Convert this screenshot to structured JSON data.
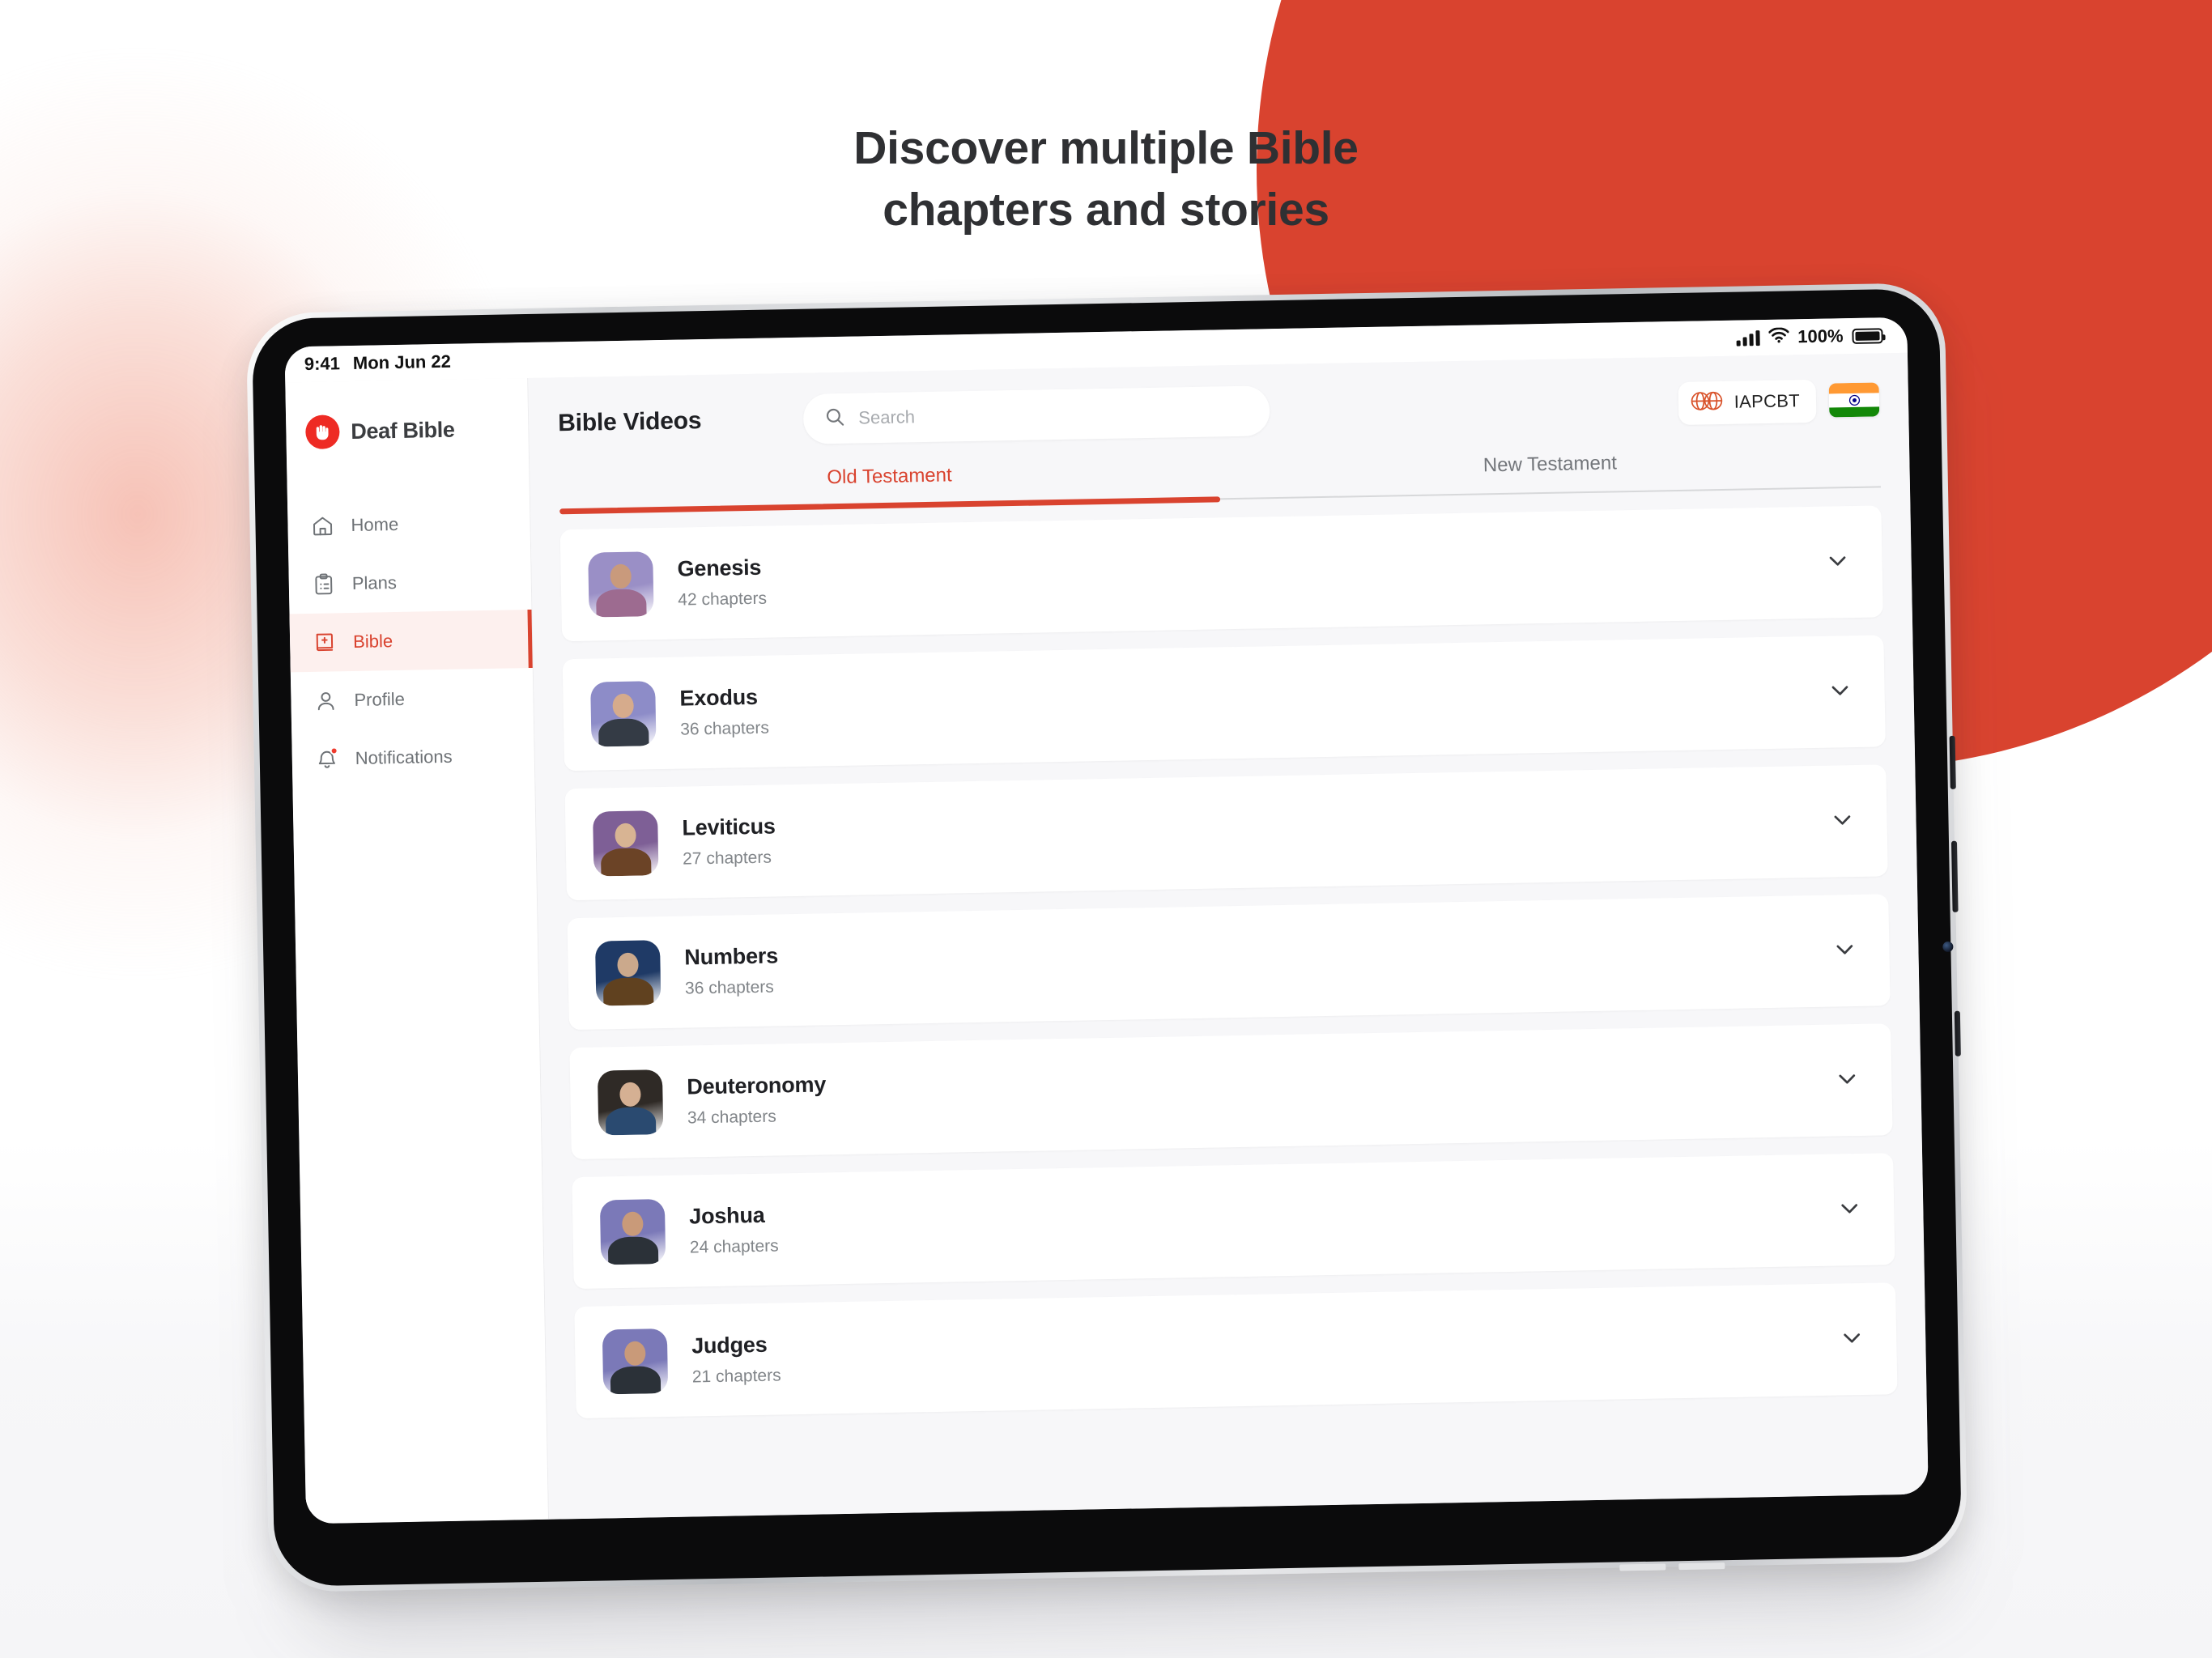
{
  "promo": {
    "headline_line1": "Discover multiple Bible",
    "headline_line2": "chapters and stories",
    "accent_red": "#d9432f",
    "blob_pink": "#f0a18c"
  },
  "status_bar": {
    "time": "9:41",
    "date": "Mon Jun 22",
    "battery_percent": "100%",
    "signal_icon": "cellular-signal-icon",
    "wifi_icon": "wifi-icon",
    "battery_icon": "battery-full-icon"
  },
  "sidebar": {
    "brand": {
      "name": "Deaf Bible",
      "logo_icon": "deaf-bible-hands-logo",
      "logo_color": "#ee2b24"
    },
    "items": [
      {
        "label": "Home",
        "icon": "home-icon",
        "active": false
      },
      {
        "label": "Plans",
        "icon": "clipboard-icon",
        "active": false
      },
      {
        "label": "Bible",
        "icon": "bible-book-icon",
        "active": true
      },
      {
        "label": "Profile",
        "icon": "person-icon",
        "active": false
      },
      {
        "label": "Notifications",
        "icon": "bell-icon",
        "active": false,
        "has_badge": true
      }
    ]
  },
  "header": {
    "title": "Bible Videos",
    "search": {
      "placeholder": "Search",
      "value": "",
      "icon": "search-icon"
    },
    "org_chip": {
      "label": "IAPCBT",
      "icon": "globes-icon",
      "icon_color": "#d9532b"
    },
    "flag": {
      "name": "india-flag",
      "saffron": "#ff9933",
      "white": "#ffffff",
      "green": "#138808",
      "chakra": "#000088"
    }
  },
  "tabs": [
    {
      "label": "Old Testament",
      "active": true
    },
    {
      "label": "New Testament",
      "active": false
    }
  ],
  "books": [
    {
      "title": "Genesis",
      "chapters": "42 chapters",
      "chevron": "chevron-down-icon",
      "thumb_bg": "#9a8fc6",
      "thumb_shirt": "#9d6b90",
      "thumb_skin": "#c99a7c"
    },
    {
      "title": "Exodus",
      "chapters": "36 chapters",
      "chevron": "chevron-down-icon",
      "thumb_bg": "#8d8cc8",
      "thumb_shirt": "#343b45",
      "thumb_skin": "#d6ab8c"
    },
    {
      "title": "Leviticus",
      "chapters": "27 chapters",
      "chevron": "chevron-down-icon",
      "thumb_bg": "#7e5f96",
      "thumb_shirt": "#6b4326",
      "thumb_skin": "#d8b493"
    },
    {
      "title": "Numbers",
      "chapters": "36 chapters",
      "chevron": "chevron-down-icon",
      "thumb_bg": "#1f3a66",
      "thumb_shirt": "#60411f",
      "thumb_skin": "#cba98c"
    },
    {
      "title": "Deuteronomy",
      "chapters": "34 chapters",
      "chevron": "chevron-down-icon",
      "thumb_bg": "#2f2a26",
      "thumb_shirt": "#2a4a70",
      "thumb_skin": "#d5b093"
    },
    {
      "title": "Joshua",
      "chapters": "24 chapters",
      "chevron": "chevron-down-icon",
      "thumb_bg": "#7b79b8",
      "thumb_shirt": "#2b3138",
      "thumb_skin": "#c99a79"
    },
    {
      "title": "Judges",
      "chapters": "21 chapters",
      "chevron": "chevron-down-icon",
      "thumb_bg": "#7b79b8",
      "thumb_shirt": "#2b3138",
      "thumb_skin": "#c99a79"
    }
  ]
}
